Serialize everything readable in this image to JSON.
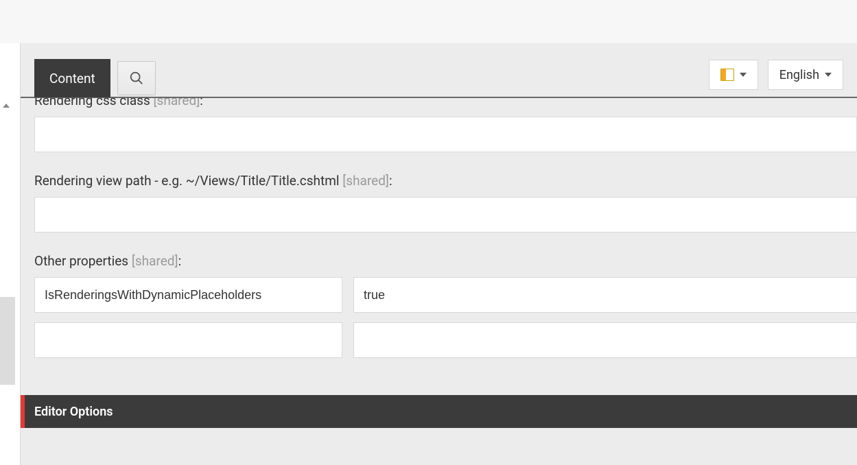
{
  "toolbar": {
    "tab_content_label": "Content",
    "language_label": "English"
  },
  "fields": {
    "rendering_css_class": {
      "label": "Rendering css class",
      "shared": "[shared]",
      "value": ""
    },
    "rendering_view_path": {
      "label": "Rendering view path - e.g. ~/Views/Title/Title.cshtml",
      "shared": "[shared]",
      "value": ""
    },
    "other_properties": {
      "label": "Other properties",
      "shared": "[shared]",
      "rows": [
        {
          "key": "IsRenderingsWithDynamicPlaceholders",
          "value": "true"
        },
        {
          "key": "",
          "value": ""
        }
      ]
    }
  },
  "sections": {
    "editor_options": "Editor Options"
  }
}
